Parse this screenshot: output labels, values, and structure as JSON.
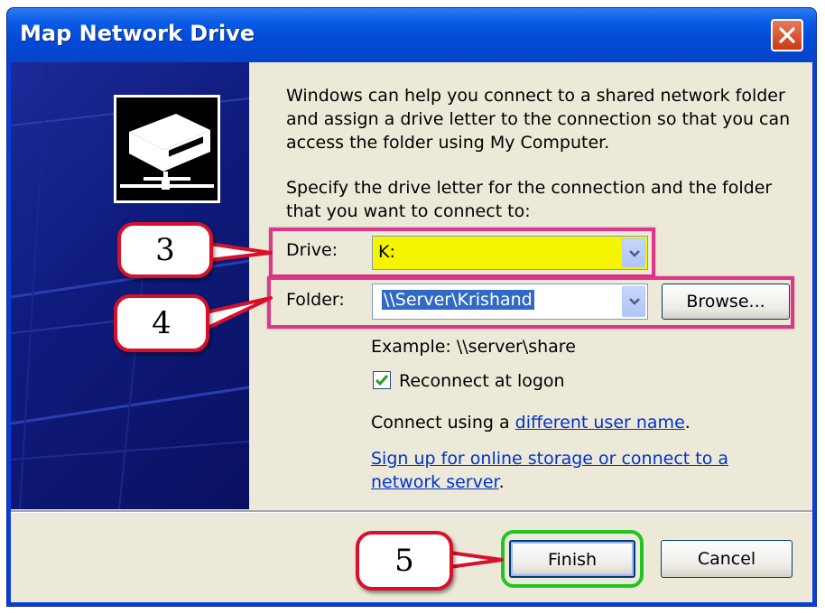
{
  "window": {
    "title": "Map Network Drive"
  },
  "intro_text": [
    "Windows can help you connect to a shared network folder",
    "and assign a drive letter to the connection so that you can",
    "access the folder using My Computer."
  ],
  "specify_text": [
    "Specify the drive letter for the connection and the folder",
    "that you want to connect to:"
  ],
  "drive": {
    "label": "Drive:",
    "value": "K:"
  },
  "folder": {
    "label": "Folder:",
    "value": "\\\\Server\\Krishand",
    "browse_label": "Browse..."
  },
  "example_text": "Example: \\\\server\\share",
  "reconnect": {
    "label": "Reconnect at logon",
    "checked": true
  },
  "connect_using": {
    "prefix": "Connect using a ",
    "link": "different user name",
    "suffix": "."
  },
  "signup": {
    "line1": "Sign up for online storage or connect to a",
    "line2": "network server",
    "suffix": "."
  },
  "buttons": {
    "finish": "Finish",
    "cancel": "Cancel"
  },
  "callouts": {
    "step3": "3",
    "step4": "4",
    "step5": "5"
  },
  "colors": {
    "highlight_pink": "#e0358a",
    "drive_yellow": "#f5f500",
    "finish_green": "#22c422",
    "callout_red": "#d8102a",
    "selection_blue": "#316ac5"
  },
  "icons": {
    "close": "close-icon",
    "drive": "network-drive-icon",
    "dropdown": "chevron-down-icon",
    "check": "checkmark-icon"
  }
}
